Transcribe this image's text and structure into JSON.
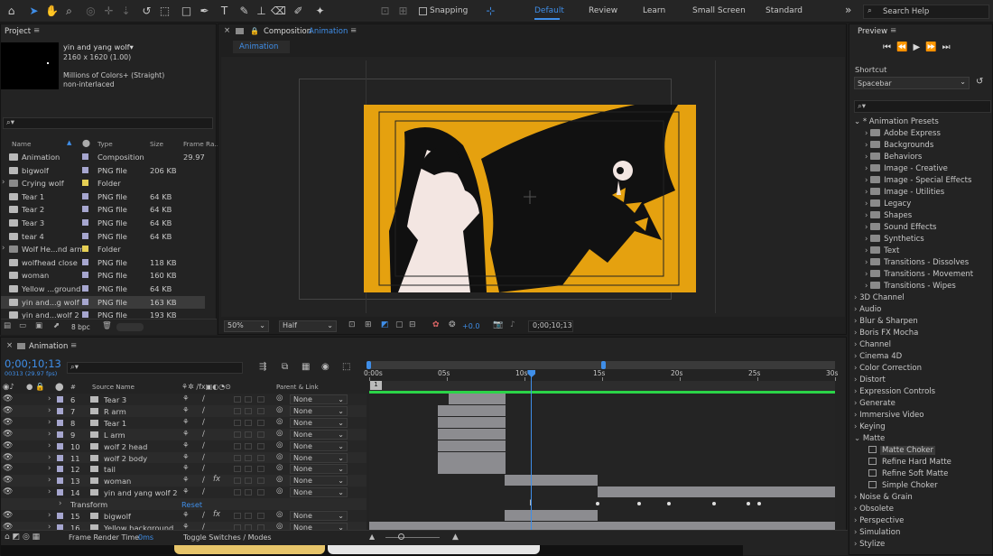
{
  "toolbar": {
    "snapping": "Snapping",
    "workspaces": [
      "Default",
      "Review",
      "Learn",
      "Small Screen",
      "Standard"
    ],
    "search_placeholder": "Search Help",
    "overflow": "»"
  },
  "project": {
    "title": "Project",
    "comp_name": "yin and yang wolf▾",
    "dims": "2160 x 1620 (1.00)",
    "colors": "Millions of Colors+ (Straight)",
    "interlace": "non-interlaced",
    "search_placeholder": "⌕▾",
    "columns": {
      "name": "Name",
      "type": "Type",
      "size": "Size",
      "frame_rate": "Frame Ra..."
    },
    "items": [
      {
        "name": "Animation",
        "type": "Composition",
        "size": "",
        "fr": "29.97",
        "color": "#a6a6cf"
      },
      {
        "name": "bigwolf",
        "type": "PNG file",
        "size": "206 KB",
        "fr": "",
        "color": "#a6a6cf"
      },
      {
        "name": "Crying wolf",
        "type": "Folder",
        "size": "",
        "fr": "",
        "color": "#e5cf54"
      },
      {
        "name": "Tear 1",
        "type": "PNG file",
        "size": "64 KB",
        "fr": "",
        "color": "#a6a6cf"
      },
      {
        "name": "Tear 2",
        "type": "PNG file",
        "size": "64 KB",
        "fr": "",
        "color": "#a6a6cf"
      },
      {
        "name": "Tear 3",
        "type": "PNG file",
        "size": "64 KB",
        "fr": "",
        "color": "#a6a6cf"
      },
      {
        "name": "tear 4",
        "type": "PNG file",
        "size": "64 KB",
        "fr": "",
        "color": "#a6a6cf"
      },
      {
        "name": "Wolf He...nd arm",
        "type": "Folder",
        "size": "",
        "fr": "",
        "color": "#e5cf54"
      },
      {
        "name": "wolfhead close",
        "type": "PNG file",
        "size": "118 KB",
        "fr": "",
        "color": "#a6a6cf"
      },
      {
        "name": "woman",
        "type": "PNG file",
        "size": "160 KB",
        "fr": "",
        "color": "#a6a6cf"
      },
      {
        "name": "Yellow ...ground",
        "type": "PNG file",
        "size": "64 KB",
        "fr": "",
        "color": "#a6a6cf"
      },
      {
        "name": "yin and...g wolf",
        "type": "PNG file",
        "size": "163 KB",
        "fr": "",
        "color": "#a6a6cf"
      },
      {
        "name": "yin and...wolf 2",
        "type": "PNG file",
        "size": "193 KB",
        "fr": "",
        "color": "#a6a6cf"
      }
    ],
    "bpc": "8 bpc"
  },
  "composition": {
    "tab_prefix": "Composition",
    "tab_name": "Animation",
    "sub_tab": "Animation",
    "zoom": "50%",
    "resolution": "Half",
    "exposure": "+0.0",
    "timecode": "0;00;10;13"
  },
  "preview": {
    "title": "Preview",
    "shortcut_label": "Shortcut",
    "shortcut_value": "Spacebar"
  },
  "effects": {
    "search_placeholder": "⌕▾",
    "presets_header": "* Animation Presets",
    "presets": [
      "Adobe Express",
      "Backgrounds",
      "Behaviors",
      "Image - Creative",
      "Image - Special Effects",
      "Image - Utilities",
      "Legacy",
      "Shapes",
      "Sound Effects",
      "Synthetics",
      "Text",
      "Transitions - Dissolves",
      "Transitions - Movement",
      "Transitions - Wipes"
    ],
    "categories_a": [
      "3D Channel",
      "Audio",
      "Blur & Sharpen",
      "Boris FX Mocha",
      "Channel",
      "Cinema 4D",
      "Color Correction",
      "Distort",
      "Expression Controls",
      "Generate",
      "Immersive Video",
      "Keying"
    ],
    "matte_label": "Matte",
    "matte_items": [
      "Matte Choker",
      "Refine Hard Matte",
      "Refine Soft Matte",
      "Simple Choker"
    ],
    "categories_b": [
      "Noise & Grain",
      "Obsolete",
      "Perspective",
      "Simulation",
      "Stylize"
    ]
  },
  "timeline": {
    "tab": "Animation",
    "timecode": "0;00;10;13",
    "frames": "00313 (29.97 fps)",
    "search_placeholder": "⌕▾",
    "col_num": "#",
    "col_source": "Source Name",
    "col_parent": "Parent & Link",
    "ruler": [
      "0:00s",
      "05s",
      "10s",
      "15s",
      "20s",
      "25s",
      "30s"
    ],
    "work_area_marker": "1",
    "layers": [
      {
        "num": "6",
        "name": "Tear 3",
        "fx": false,
        "parent": "None"
      },
      {
        "num": "7",
        "name": "R arm",
        "fx": false,
        "parent": "None"
      },
      {
        "num": "8",
        "name": "Tear 1",
        "fx": false,
        "parent": "None"
      },
      {
        "num": "9",
        "name": "L arm",
        "fx": false,
        "parent": "None"
      },
      {
        "num": "10",
        "name": "wolf 2 head",
        "fx": false,
        "parent": "None"
      },
      {
        "num": "11",
        "name": "wolf 2 body",
        "fx": false,
        "parent": "None"
      },
      {
        "num": "12",
        "name": "tail",
        "fx": false,
        "parent": "None"
      },
      {
        "num": "13",
        "name": "woman",
        "fx": true,
        "parent": "None"
      },
      {
        "num": "14",
        "name": "yin and yang wolf 2",
        "fx": false,
        "parent": "None"
      },
      {
        "num": "15",
        "name": "bigwolf",
        "fx": true,
        "parent": "None"
      },
      {
        "num": "16",
        "name": "Yellow background",
        "fx": false,
        "parent": "None"
      }
    ],
    "bar_starts_s": [
      5.1,
      4.4,
      4.4,
      4.4,
      4.4,
      4.4,
      4.4,
      8.7,
      14.7,
      8.7,
      0
    ],
    "bar_ends_s": [
      8.8,
      8.8,
      8.8,
      8.8,
      8.8,
      8.8,
      8.8,
      14.7,
      30,
      14.7,
      30
    ],
    "transform_label": "Transform",
    "reset_label": "Reset",
    "keyframes_s": [
      14.7,
      17.4,
      19.3,
      22.2,
      24.4,
      25.1
    ],
    "frame_render_label": "Frame Render Time",
    "frame_render_value": "0ms",
    "toggle_label": "Toggle Switches / Modes",
    "duration_s": 30,
    "current_s": 10.43
  }
}
